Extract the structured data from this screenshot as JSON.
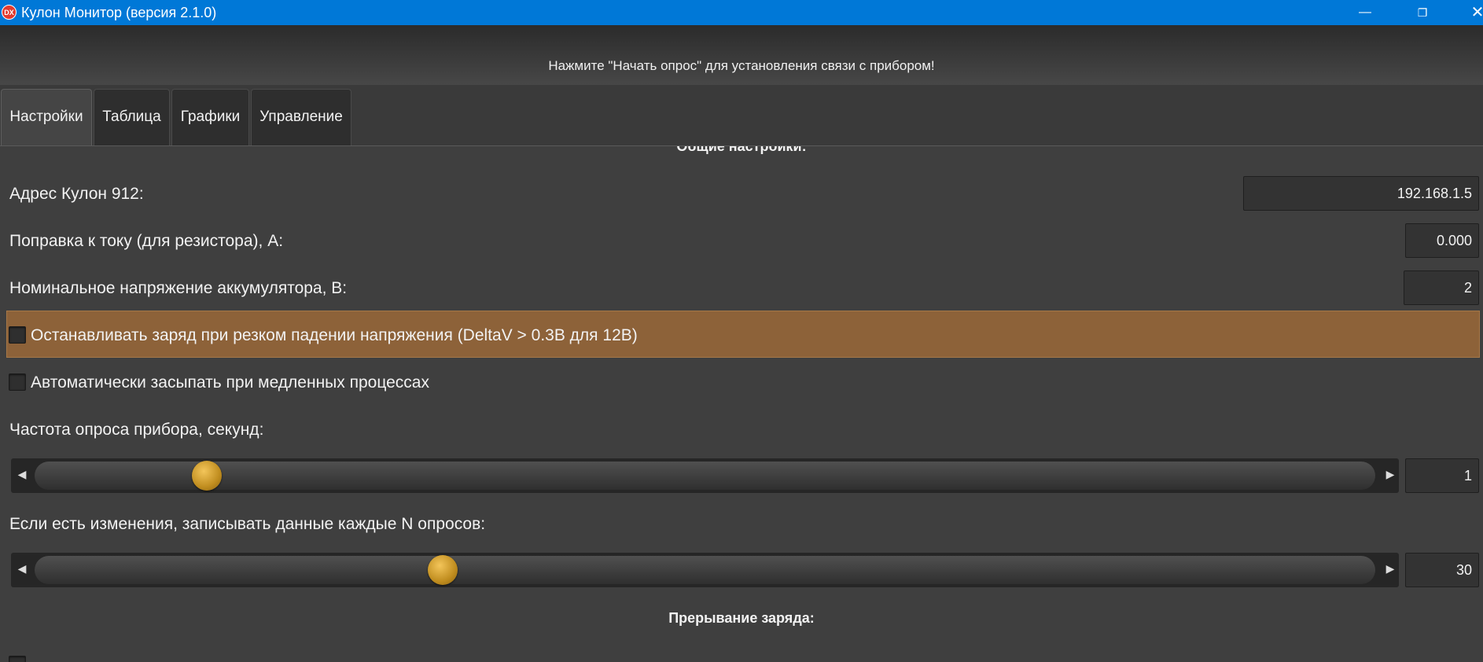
{
  "window": {
    "title": "Кулон Монитор (версия 2.1.0)",
    "app_icon_text": "DX",
    "minimize_glyph": "—",
    "restore_glyph": "❐",
    "close_glyph": "✕",
    "accent_color": "#0078d7"
  },
  "banner": {
    "message": "Нажмите \"Начать опрос\" для установления связи с прибором!"
  },
  "tabs": [
    {
      "label": "Настройки",
      "active": true
    },
    {
      "label": "Таблица",
      "active": false
    },
    {
      "label": "Графики",
      "active": false
    },
    {
      "label": "Управление",
      "active": false
    }
  ],
  "settings": {
    "general_title": "Общие настройки:",
    "address_label": "Адрес Кулон 912:",
    "address_value": "192.168.1.5",
    "current_offset_label": "Поправка к току (для резистора), А:",
    "current_offset_value": "0.000",
    "nominal_voltage_label": "Номинальное напряжение аккумулятора, В:",
    "nominal_voltage_value": "2",
    "stop_on_drop_label": "Останавливать заряд при резком падении напряжения (DeltaV > 0.3В для 12В)",
    "stop_on_drop_checked": false,
    "auto_sleep_label": "Автоматически засыпать при медленных процессах",
    "auto_sleep_checked": false,
    "poll_rate_label": "Частота опроса прибора, секунд:",
    "poll_rate_value": "1",
    "poll_rate_fraction": 0.12,
    "record_every_label": "Если есть изменения, записывать данные каждые N опросов:",
    "record_every_value": "30",
    "record_every_fraction": 0.3,
    "interrupt_title": "Прерывание заряда:",
    "highlight_color": "#8d6239",
    "slider_left_glyph": "◀",
    "slider_right_glyph": "▶"
  }
}
